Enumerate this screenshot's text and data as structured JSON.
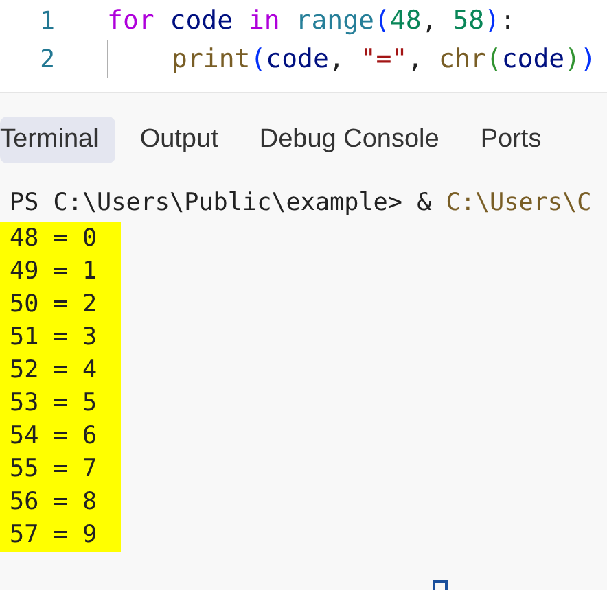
{
  "editor": {
    "lines": [
      {
        "number": "1",
        "tokens": [
          {
            "kind": "keyword",
            "text": "for "
          },
          {
            "kind": "variable",
            "text": "code "
          },
          {
            "kind": "keyword",
            "text": "in "
          },
          {
            "kind": "builtin",
            "text": "range"
          },
          {
            "kind": "bracket",
            "text": "("
          },
          {
            "kind": "number",
            "text": "48"
          },
          {
            "kind": "plain",
            "text": ", "
          },
          {
            "kind": "number",
            "text": "58"
          },
          {
            "kind": "bracket",
            "text": ")"
          },
          {
            "kind": "plain",
            "text": ":"
          }
        ]
      },
      {
        "number": "2",
        "indent": true,
        "tokens": [
          {
            "kind": "function",
            "text": "print"
          },
          {
            "kind": "bracket",
            "text": "("
          },
          {
            "kind": "variable",
            "text": "code"
          },
          {
            "kind": "plain",
            "text": ", "
          },
          {
            "kind": "string",
            "text": "\"=\""
          },
          {
            "kind": "plain",
            "text": ", "
          },
          {
            "kind": "function",
            "text": "chr"
          },
          {
            "kind": "bracket2",
            "text": "("
          },
          {
            "kind": "variable",
            "text": "code"
          },
          {
            "kind": "bracket2",
            "text": ")"
          },
          {
            "kind": "bracket",
            "text": ")"
          }
        ]
      }
    ]
  },
  "panel": {
    "tabs": [
      {
        "label": "Terminal",
        "selected": true
      },
      {
        "label": "Output",
        "selected": false
      },
      {
        "label": "Debug Console",
        "selected": false
      },
      {
        "label": "Ports",
        "selected": false
      }
    ],
    "terminal": {
      "prompt": [
        {
          "kind": "plain",
          "text": "PS C:\\Users\\Public\\example> & "
        },
        {
          "kind": "path",
          "text": "C:\\Users\\C"
        }
      ],
      "output_highlighted": true,
      "output": [
        "48 = 0",
        "49 = 1",
        "50 = 2",
        "51 = 3",
        "52 = 4",
        "53 = 5",
        "54 = 6",
        "55 = 7",
        "56 = 8",
        "57 = 9"
      ]
    }
  }
}
